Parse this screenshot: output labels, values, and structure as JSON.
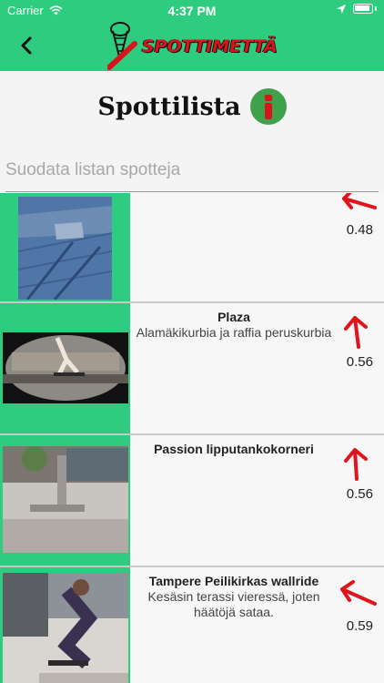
{
  "status_bar": {
    "carrier": "Carrier",
    "time": "4:37 PM"
  },
  "header": {
    "logo_text": "SPOTTIMETTÄ"
  },
  "page": {
    "title": "Spottilista"
  },
  "search": {
    "placeholder": "Suodata listan spotteja",
    "value": ""
  },
  "spots": [
    {
      "name": "",
      "description": "",
      "distance": "0.48"
    },
    {
      "name": "Plaza",
      "description": "Alamäkikurbia ja raffia peruskurbia",
      "distance": "0.56"
    },
    {
      "name": "Passion lipputankokorneri",
      "description": "",
      "distance": "0.56"
    },
    {
      "name": "Tampere Peilikirkas wallride",
      "description": "Kesäsin terassi vieressä, joten häätöjä sataa.",
      "distance": "0.59"
    }
  ],
  "colors": {
    "header": "#2ecc7e",
    "accent_red": "#d8141c",
    "info_green": "#3fa14a"
  }
}
